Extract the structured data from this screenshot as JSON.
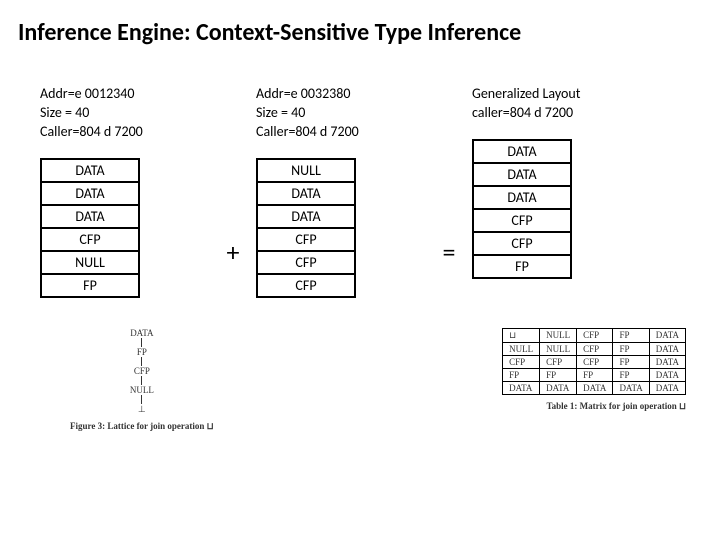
{
  "title": "Inference Engine: Context-Sensitive Type Inference",
  "ops": {
    "plus": "+",
    "equals": "="
  },
  "blocks": {
    "a": {
      "header": "Addr=e 0012340\nSize = 40\nCaller=804 d 7200",
      "cells": [
        "DATA",
        "DATA",
        "DATA",
        "CFP",
        "NULL",
        "FP"
      ]
    },
    "b": {
      "header": "Addr=e 0032380\nSize = 40\nCaller=804 d 7200",
      "cells": [
        "NULL",
        "DATA",
        "DATA",
        "CFP",
        "CFP",
        "CFP"
      ]
    },
    "c": {
      "header": "Generalized Layout\ncaller=804 d 7200",
      "cells": [
        "DATA",
        "DATA",
        "DATA",
        "CFP",
        "CFP",
        "FP"
      ]
    }
  },
  "lattice": {
    "nodes": [
      "DATA",
      "FP",
      "CFP",
      "NULL",
      "⊥"
    ],
    "caption": "Figure 3: Lattice for join operation ⊔"
  },
  "matrix": {
    "col_headers": [
      "⊔",
      "NULL",
      "CFP",
      "FP",
      "DATA"
    ],
    "rows": [
      [
        "NULL",
        "NULL",
        "CFP",
        "FP",
        "DATA"
      ],
      [
        "CFP",
        "CFP",
        "CFP",
        "FP",
        "DATA"
      ],
      [
        "FP",
        "FP",
        "FP",
        "FP",
        "DATA"
      ],
      [
        "DATA",
        "DATA",
        "DATA",
        "DATA",
        "DATA"
      ]
    ],
    "caption": "Table 1: Matrix for join operation ⊔"
  }
}
